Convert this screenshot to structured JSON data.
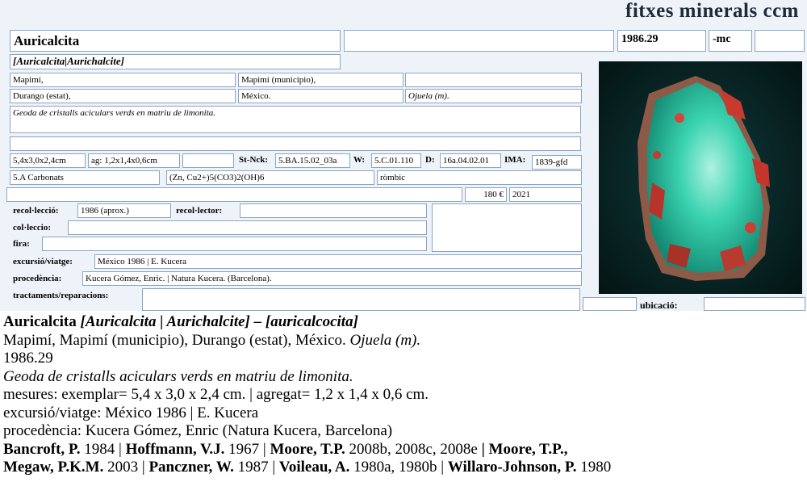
{
  "brand": "fitxes minerals ccm",
  "card": {
    "name": "Auricalcita",
    "code": "1986.29",
    "suffix": "-mc",
    "synonyms": "[Auricalcita|Aurichalcite]",
    "loc1": "Mapimí,",
    "loc2": "Mapimí (municipio),",
    "loc3": "Durango (estat),",
    "loc4": "México.",
    "loc5": "Ojuela (m).",
    "description": "Geoda de cristalls aciculars verds en matriu de limonita.",
    "size": "5,4x3,0x2,4cm",
    "aggregate": "ag: 1,2x1,4x0,6cm",
    "stnck_label": "St-Nck:",
    "stnck": "5.BA.15.02_03a",
    "w_label": "W:",
    "w": "5.C.01.110",
    "d_label": "D:",
    "d": "16a.04.02.01",
    "ima_label": "IMA:",
    "ima": "1839-gfd",
    "class": "5.A Carbonats",
    "formula": "(Zn, Cu2+)5(CO3)2(OH)6",
    "system": "ròmbic",
    "price": "180 €",
    "year": "2021",
    "recol_label": "recol·lecció:",
    "recol": "1986 (aprox.)",
    "recollector_label": "recol·lector:",
    "collection_label": "col·leccio:",
    "fair_label": "fira:",
    "trip_label": "excursió/viatge:",
    "trip": "México 1986 | E. Kucera",
    "origin_label": "procedència:",
    "origin": "Kucera Gómez, Enric. | Natura Kucera. (Barcelona).",
    "treat_label": "tractaments/reparacions:",
    "location_label": "ubicació:"
  },
  "summary": {
    "title_name": "Auricalcita",
    "title_syn": "[Auricalcita | Aurichalcite] – [auricalcocita]",
    "loc_plain": "Mapimí, Mapimí (municipio), Durango (estat), México.",
    "loc_italic": "Ojuela (m).",
    "code": "1986.29",
    "description": "Geoda de cristalls aciculars verds en matriu de limonita.",
    "measures": "mesures: exemplar= 5,4 x 3,0 x 2,4 cm. | agregat= 1,2 x 1,4 x 0,6 cm.",
    "trip": "excursió/viatge: México 1986 | E. Kucera",
    "origin": "procedència: Kucera Gómez, Enric (Natura Kucera, Barcelona)",
    "refs": {
      "a1": "Bancroft, P.",
      "a2": " 1984 | ",
      "b1": "Hoffmann, V.J.",
      "b2": " 1967 | ",
      "c1": "Moore, T.P.",
      "c2": " 2008b, 2008c, 2008e ",
      "c3": "| Moore, T.P.,",
      "d1": "Megaw, P.K.M.",
      "d2": " 2003 | ",
      "e1": "Panczner, W.",
      "e2": " 1987 | ",
      "f1": "Voileau, A.",
      "f2": " 1980a, 1980b | ",
      "g1": "Willaro-Johnson, P.",
      "g2": " 1980"
    }
  }
}
